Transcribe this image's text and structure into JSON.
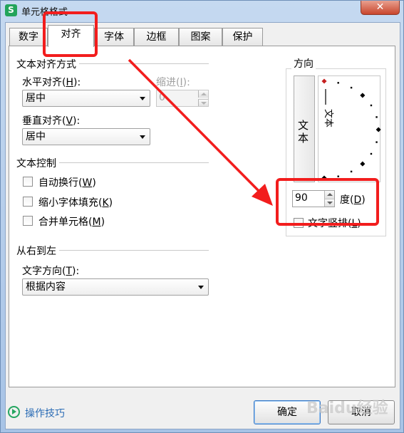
{
  "window": {
    "title": "单元格格式",
    "app_icon_letter": "S",
    "close_label": "✕"
  },
  "tabs": [
    {
      "label": "数字",
      "active": false
    },
    {
      "label": "对齐",
      "active": true
    },
    {
      "label": "字体",
      "active": false
    },
    {
      "label": "边框",
      "active": false
    },
    {
      "label": "图案",
      "active": false
    },
    {
      "label": "保护",
      "active": false
    }
  ],
  "text_alignment": {
    "group_title": "文本对齐方式",
    "horizontal_label_pre": "水平对齐(",
    "horizontal_label_key": "H",
    "horizontal_label_post": "):",
    "horizontal_value": "居中",
    "indent_label_pre": "缩进(",
    "indent_label_key": "I",
    "indent_label_post": "):",
    "indent_value": "0",
    "vertical_label_pre": "垂直对齐(",
    "vertical_label_key": "V",
    "vertical_label_post": "):",
    "vertical_value": "居中"
  },
  "text_control": {
    "group_title": "文本控制",
    "wrap_pre": "自动换行(",
    "wrap_key": "W",
    "wrap_post": ")",
    "shrink_pre": "缩小字体填充(",
    "shrink_key": "K",
    "shrink_post": ")",
    "merge_pre": "合并单元格(",
    "merge_key": "M",
    "merge_post": ")"
  },
  "rtl": {
    "group_title": "从右到左",
    "direction_label_pre": "文字方向(",
    "direction_label_key": "T",
    "direction_label_post": "):",
    "direction_value": "根据内容"
  },
  "orientation": {
    "group_title": "方向",
    "vertical_text_char1": "文",
    "vertical_text_char2": "本",
    "dial_text": "文本",
    "degrees_value": "90",
    "degrees_label_pre": "度(",
    "degrees_label_key": "D",
    "degrees_label_post": ")",
    "vertical_checkbox_pre": "文字竖排(",
    "vertical_checkbox_key": "L",
    "vertical_checkbox_post": ")"
  },
  "footer": {
    "tips_link": "操作技巧",
    "ok_label": "确定",
    "cancel_label": "取消"
  },
  "watermark": "Baidu经验",
  "colors": {
    "annotation_red": "#f21d1d",
    "link_blue": "#2b6cb5",
    "dial_marker_red": "#c62020"
  }
}
